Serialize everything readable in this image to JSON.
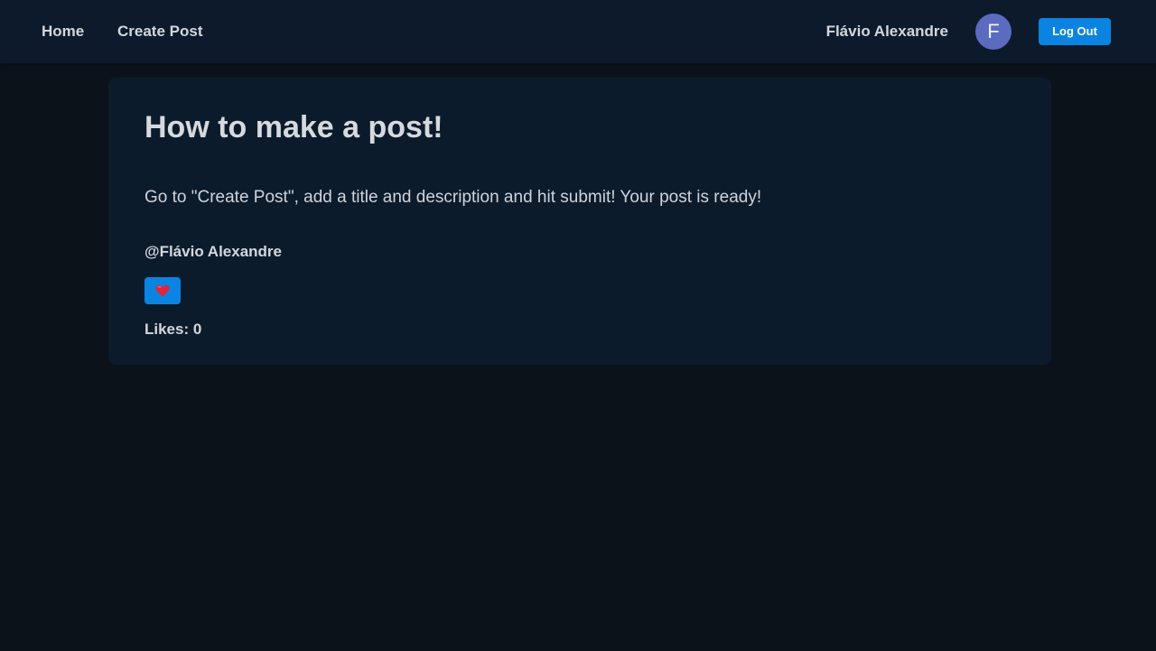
{
  "nav": {
    "home_label": "Home",
    "create_post_label": "Create Post",
    "user_name": "Flávio Alexandre",
    "avatar_initial": "F",
    "logout_label": "Log Out"
  },
  "post": {
    "title": "How to make a post!",
    "body": "Go to \"Create Post\", add a title and description and hit submit! Your post is ready!",
    "author": "@Flávio Alexandre",
    "like_icon": "heart-icon",
    "likes_text": "Likes: 0"
  },
  "colors": {
    "page_background": "#0c121a",
    "navbar_background": "#0c1a2b",
    "card_background": "#0c1b2c",
    "accent": "#0a84e0",
    "avatar": "#5b6bbf",
    "heart": "#e0243a",
    "text": "#d3d7dd"
  }
}
